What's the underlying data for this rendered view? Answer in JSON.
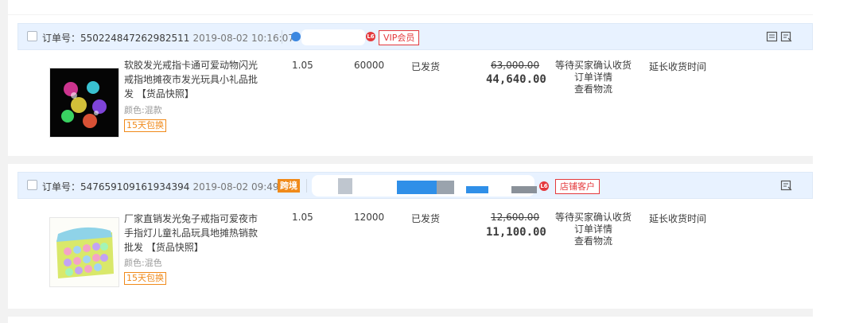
{
  "orders": [
    {
      "order_no": "订单号：550224847262982511",
      "time": "2019-08-02 10:16:07",
      "badge": "VIP会员",
      "item_title": "软胶发光戒指卡通可爱动物闪光戒指地摊夜市发光玩具小礼品批发 【货品快照】",
      "color": "颜色:混款",
      "tag": "15天包换",
      "unit_price": "1.05",
      "quantity": "60000",
      "ship_status": "已发货",
      "original_total": "63,000.00",
      "final_total": "44,640.00",
      "status_lines": [
        "等待买家确认收货",
        "订单详情",
        "查看物流"
      ],
      "action": "延长收货时间",
      "icons": [
        "note-icon",
        "flag-icon"
      ]
    },
    {
      "order_no": "订单号：547659109161934394",
      "time": "2019-08-02 09:49:35",
      "cross_border": "跨境",
      "badge": "店铺客户",
      "item_title": "厂家直销发光兔子戒指可爱夜市手指灯儿童礼品玩具地摊热销款批发 【货品快照】",
      "color": "颜色:混色",
      "tag": "15天包换",
      "unit_price": "1.05",
      "quantity": "12000",
      "ship_status": "已发货",
      "original_total": "12,600.00",
      "final_total": "11,100.00",
      "status_lines": [
        "等待买家确认收货",
        "订单详情",
        "查看物流"
      ],
      "action": "延长收货时间",
      "icons": [
        "flag-icon"
      ]
    }
  ],
  "colors": {
    "header_bg": "#e8f2ff",
    "badge_red": "#e4393c",
    "orange": "#f08a1a"
  }
}
